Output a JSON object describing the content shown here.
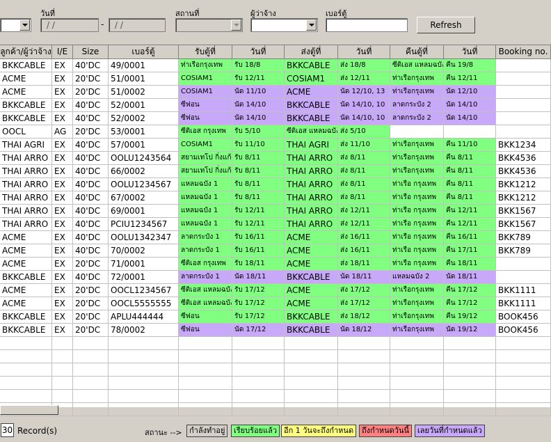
{
  "filters": {
    "date_label": "วันที่",
    "date_from": "/ /",
    "date_separator": "-",
    "date_to": "/ /",
    "place_label": "สถานที่",
    "employer_label": "ผู้ว่าจ้าง",
    "container_label": "เบอร์ตู้",
    "refresh_label": "Refresh"
  },
  "grid": {
    "columns": [
      "ลูกค้า/ผู้ว่าจ้าง",
      "I/E",
      "Size",
      "เบอร์ตู้",
      "รับตู้ที่",
      "วันที่",
      "ส่งตู้ที่",
      "วันที่",
      "คืนตู้ที่",
      "วันที่",
      "Booking no."
    ],
    "rows": [
      {
        "c": [
          "BKKCABLE",
          "EX",
          "40'DC",
          "49/0001",
          "ท่าเรือกรุงเทพ",
          "รับ 18/8",
          "BKKCABLE",
          "ส่ง 18/8",
          "ซีติเอส แหลมฉบัง",
          "คืน 19/8",
          ""
        ],
        "color": "green"
      },
      {
        "c": [
          "ACME",
          "EX",
          "20'DC",
          "51/0001",
          "COSIAM1",
          "รับ 12/11",
          "COSIAM1",
          "ส่ง 12/11",
          "ท่าเรือกรุงเทพ",
          "คืน 12/11",
          ""
        ],
        "color": "green"
      },
      {
        "c": [
          "ACME",
          "EX",
          "20'DC",
          "51/0002",
          "COSIAM1",
          "นัด 11/10",
          "ACME",
          "นัด 12/10, 13",
          "ท่าเรือกรุงเทพ",
          "นัด 12/10",
          ""
        ],
        "color": "purple"
      },
      {
        "c": [
          "BKKCABLE",
          "EX",
          "40'DC",
          "52/0001",
          "ซีฟอน",
          "นัด 14/10",
          "BKKCABLE",
          "นัด 14/10, 10",
          "ลาดกระบัง 2",
          "นัด 14/10",
          ""
        ],
        "color": "purple"
      },
      {
        "c": [
          "BKKCABLE",
          "EX",
          "40'DC",
          "52/0002",
          "ซีฟอน",
          "นัด 14/10",
          "BKKCABLE",
          "นัด 14/10, 10",
          "ลาดกระบัง 2",
          "นัด 14/10",
          ""
        ],
        "color": "purple"
      },
      {
        "c": [
          "OOCL",
          "AG",
          "20'DC",
          "53/0001",
          "ซีติเอส กรุงเทพ",
          "รับ 5/10",
          "ซีติเอส แหลมฉบัง",
          "ส่ง 5/10",
          "",
          "",
          ""
        ],
        "color": "green",
        "partial": true
      },
      {
        "c": [
          "THAI AGRI",
          "EX",
          "40'DC",
          "57/0001",
          "COSIAM1",
          "รับ 11/10",
          "THAI AGRI",
          "ส่ง 11/10",
          "ท่าเรือกรุงเทพ",
          "คืน 11/10",
          "BKK1234"
        ],
        "color": "green"
      },
      {
        "c": [
          "THAI ARRO",
          "EX",
          "40'DC",
          "OOLU1243564",
          "สยามเทโป กิ่งแก้ว",
          "รับ 8/11",
          "THAI ARRO",
          "ส่ง 8/11",
          "ท่าเรือกรุงเทพ",
          "คืน 8/11",
          "BKK4536"
        ],
        "color": "green"
      },
      {
        "c": [
          "THAI ARRO",
          "EX",
          "40'DC",
          "66/0002",
          "สยามเทโป กิ่งแก้ว",
          "รับ 8/11",
          "THAI ARRO",
          "ส่ง 8/11",
          "ท่าเรือกรุงเทพ",
          "คืน 8/11",
          "BKK4536"
        ],
        "color": "green"
      },
      {
        "c": [
          "THAI ARRO",
          "EX",
          "40'DC",
          "OOLU1234567",
          "แหลมฉบัง 1",
          "รับ 8/11",
          "THAI ARRO",
          "ส่ง 8/11",
          "ท่าเรือ กรุงเทพ",
          "คืน 8/11",
          "BKK1212"
        ],
        "color": "green"
      },
      {
        "c": [
          "THAI ARRO",
          "EX",
          "40'DC",
          "67/0002",
          "แหลมฉบัง 1",
          "รับ 8/11",
          "THAI ARRO",
          "ส่ง 8/11",
          "ท่าเรือ กรุงเทพ",
          "คืน 8/11",
          "BKK1212"
        ],
        "color": "green"
      },
      {
        "c": [
          "THAI ARRO",
          "EX",
          "40'DC",
          "69/0001",
          "แหลมฉบัง 1",
          "รับ 12/11",
          "THAI ARRO",
          "ส่ง 12/11",
          "ท่าเรือ กรุงเทพ",
          "คืน 12/11",
          "BKK1567"
        ],
        "color": "green"
      },
      {
        "c": [
          "THAI ARRO",
          "EX",
          "40'DC",
          "PCIU1234567",
          "แหลมฉบัง 1",
          "รับ 12/11",
          "THAI ARRO",
          "ส่ง 12/11",
          "ท่าเรือ กรุงเทพ",
          "คืน 12/11",
          "BKK1567"
        ],
        "color": "green"
      },
      {
        "c": [
          "ACME",
          "EX",
          "40'DC",
          "OOLU1342347",
          "ลาดกระบัง 1",
          "รับ 16/11",
          "ACME",
          "ส่ง 16/11",
          "ท่าเรือ กรุงเทพ",
          "คืน 16/11",
          "BKK789"
        ],
        "color": "green"
      },
      {
        "c": [
          "ACME",
          "EX",
          "40'DC",
          "70/0002",
          "ลาดกระบัง 1",
          "รับ 16/11",
          "ACME",
          "ส่ง 16/11",
          "ท่าเรือ กรุงเทพ",
          "คืน 17/11",
          "BKK789"
        ],
        "color": "green"
      },
      {
        "c": [
          "ACME",
          "EX",
          "20'DC",
          "71/0001",
          "ซีติเอส กรุงเทพ",
          "รับ 18/11",
          "ACME",
          "ส่ง 18/11",
          "ท่าเรือ กรุงเทพ",
          "คืน 18/11",
          ""
        ],
        "color": "green"
      },
      {
        "c": [
          "BKKCABLE",
          "EX",
          "40'DC",
          "72/0001",
          "ลาดกระบัง 1",
          "นัด 18/11",
          "BKKCABLE",
          "นัด 18/11",
          "แหลมฉบัง 2",
          "นัด 18/11",
          ""
        ],
        "color": "purple"
      },
      {
        "c": [
          "ACME",
          "EX",
          "20'DC",
          "OOCL1234567",
          "ซีติเอส แหลมฉบัง",
          "รับ 17/12",
          "ACME",
          "ส่ง 17/12",
          "ท่าเรือกรุงเทพ",
          "คืน 17/12",
          "BKK1111"
        ],
        "color": "green"
      },
      {
        "c": [
          "ACME",
          "EX",
          "20'DC",
          "OOCL5555555",
          "ซีติเอส แหลมฉบัง",
          "รับ 17/12",
          "ACME",
          "ส่ง 17/12",
          "ท่าเรือกรุงเทพ",
          "คืน 17/12",
          "BKK1111"
        ],
        "color": "green"
      },
      {
        "c": [
          "BKKCABLE",
          "EX",
          "20'DC",
          "APLU444444",
          "ซีฟอน",
          "รับ 17/12",
          "BKKCABLE",
          "ส่ง 18/12",
          "ท่าเรือกรุงเทพ",
          "คืน 19/12",
          "BOOK456"
        ],
        "color": "green"
      },
      {
        "c": [
          "BKKCABLE",
          "EX",
          "20'DC",
          "78/0002",
          "ซีฟอน",
          "นัด 17/12",
          "BKKCABLE",
          "นัด 18/12",
          "ท่าเรือกรุงเทพ",
          "นัด 19/12",
          "BOOK456"
        ],
        "color": "purple"
      }
    ]
  },
  "status": {
    "record_count": "30",
    "record_label": "Record(s)",
    "status_label": "สถานะ -->",
    "legend": [
      {
        "label": "กำลังทำอยู่",
        "color": "#d4d0c8"
      },
      {
        "label": "เรียบร้อยแล้ว",
        "color": "#80ff80"
      },
      {
        "label": "อีก 1 วันจะถึงกำหนด",
        "color": "#ffff80"
      },
      {
        "label": "ถึงกำหนดวันนี้",
        "color": "#ff8080"
      },
      {
        "label": "เลยวันที่กำหนดแล้ว",
        "color": "#c8a8f8"
      }
    ]
  },
  "colors": {
    "done": "#80ff80",
    "overdue": "#c8a8f8"
  }
}
